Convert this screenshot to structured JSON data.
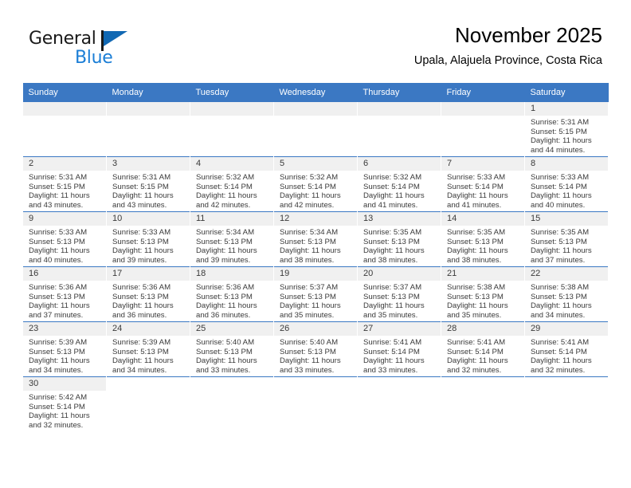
{
  "logo": {
    "word1": "General",
    "word2": "Blue",
    "flag_color": "#1168b3",
    "word2_color": "#1b7ed6"
  },
  "header": {
    "title": "November 2025",
    "subtitle": "Upala, Alajuela Province, Costa Rica"
  },
  "theme": {
    "header_blue": "#3b78c3",
    "daynum_bg": "#f0f0f0",
    "text": "#3a3a3a"
  },
  "weekdays": [
    "Sunday",
    "Monday",
    "Tuesday",
    "Wednesday",
    "Thursday",
    "Friday",
    "Saturday"
  ],
  "labels": {
    "sunrise_prefix": "Sunrise: ",
    "sunset_prefix": "Sunset: ",
    "daylight_prefix": "Daylight: "
  },
  "weeks": [
    [
      {
        "blank": true
      },
      {
        "blank": true
      },
      {
        "blank": true
      },
      {
        "blank": true
      },
      {
        "blank": true
      },
      {
        "blank": true
      },
      {
        "day": "1",
        "line1": "Sunrise: 5:31 AM",
        "line2": "Sunset: 5:15 PM",
        "line3": "Daylight: 11 hours",
        "line4": "and 44 minutes."
      }
    ],
    [
      {
        "day": "2",
        "line1": "Sunrise: 5:31 AM",
        "line2": "Sunset: 5:15 PM",
        "line3": "Daylight: 11 hours",
        "line4": "and 43 minutes."
      },
      {
        "day": "3",
        "line1": "Sunrise: 5:31 AM",
        "line2": "Sunset: 5:15 PM",
        "line3": "Daylight: 11 hours",
        "line4": "and 43 minutes."
      },
      {
        "day": "4",
        "line1": "Sunrise: 5:32 AM",
        "line2": "Sunset: 5:14 PM",
        "line3": "Daylight: 11 hours",
        "line4": "and 42 minutes."
      },
      {
        "day": "5",
        "line1": "Sunrise: 5:32 AM",
        "line2": "Sunset: 5:14 PM",
        "line3": "Daylight: 11 hours",
        "line4": "and 42 minutes."
      },
      {
        "day": "6",
        "line1": "Sunrise: 5:32 AM",
        "line2": "Sunset: 5:14 PM",
        "line3": "Daylight: 11 hours",
        "line4": "and 41 minutes."
      },
      {
        "day": "7",
        "line1": "Sunrise: 5:33 AM",
        "line2": "Sunset: 5:14 PM",
        "line3": "Daylight: 11 hours",
        "line4": "and 41 minutes."
      },
      {
        "day": "8",
        "line1": "Sunrise: 5:33 AM",
        "line2": "Sunset: 5:14 PM",
        "line3": "Daylight: 11 hours",
        "line4": "and 40 minutes."
      }
    ],
    [
      {
        "day": "9",
        "line1": "Sunrise: 5:33 AM",
        "line2": "Sunset: 5:13 PM",
        "line3": "Daylight: 11 hours",
        "line4": "and 40 minutes."
      },
      {
        "day": "10",
        "line1": "Sunrise: 5:33 AM",
        "line2": "Sunset: 5:13 PM",
        "line3": "Daylight: 11 hours",
        "line4": "and 39 minutes."
      },
      {
        "day": "11",
        "line1": "Sunrise: 5:34 AM",
        "line2": "Sunset: 5:13 PM",
        "line3": "Daylight: 11 hours",
        "line4": "and 39 minutes."
      },
      {
        "day": "12",
        "line1": "Sunrise: 5:34 AM",
        "line2": "Sunset: 5:13 PM",
        "line3": "Daylight: 11 hours",
        "line4": "and 38 minutes."
      },
      {
        "day": "13",
        "line1": "Sunrise: 5:35 AM",
        "line2": "Sunset: 5:13 PM",
        "line3": "Daylight: 11 hours",
        "line4": "and 38 minutes."
      },
      {
        "day": "14",
        "line1": "Sunrise: 5:35 AM",
        "line2": "Sunset: 5:13 PM",
        "line3": "Daylight: 11 hours",
        "line4": "and 38 minutes."
      },
      {
        "day": "15",
        "line1": "Sunrise: 5:35 AM",
        "line2": "Sunset: 5:13 PM",
        "line3": "Daylight: 11 hours",
        "line4": "and 37 minutes."
      }
    ],
    [
      {
        "day": "16",
        "line1": "Sunrise: 5:36 AM",
        "line2": "Sunset: 5:13 PM",
        "line3": "Daylight: 11 hours",
        "line4": "and 37 minutes."
      },
      {
        "day": "17",
        "line1": "Sunrise: 5:36 AM",
        "line2": "Sunset: 5:13 PM",
        "line3": "Daylight: 11 hours",
        "line4": "and 36 minutes."
      },
      {
        "day": "18",
        "line1": "Sunrise: 5:36 AM",
        "line2": "Sunset: 5:13 PM",
        "line3": "Daylight: 11 hours",
        "line4": "and 36 minutes."
      },
      {
        "day": "19",
        "line1": "Sunrise: 5:37 AM",
        "line2": "Sunset: 5:13 PM",
        "line3": "Daylight: 11 hours",
        "line4": "and 35 minutes."
      },
      {
        "day": "20",
        "line1": "Sunrise: 5:37 AM",
        "line2": "Sunset: 5:13 PM",
        "line3": "Daylight: 11 hours",
        "line4": "and 35 minutes."
      },
      {
        "day": "21",
        "line1": "Sunrise: 5:38 AM",
        "line2": "Sunset: 5:13 PM",
        "line3": "Daylight: 11 hours",
        "line4": "and 35 minutes."
      },
      {
        "day": "22",
        "line1": "Sunrise: 5:38 AM",
        "line2": "Sunset: 5:13 PM",
        "line3": "Daylight: 11 hours",
        "line4": "and 34 minutes."
      }
    ],
    [
      {
        "day": "23",
        "line1": "Sunrise: 5:39 AM",
        "line2": "Sunset: 5:13 PM",
        "line3": "Daylight: 11 hours",
        "line4": "and 34 minutes."
      },
      {
        "day": "24",
        "line1": "Sunrise: 5:39 AM",
        "line2": "Sunset: 5:13 PM",
        "line3": "Daylight: 11 hours",
        "line4": "and 34 minutes."
      },
      {
        "day": "25",
        "line1": "Sunrise: 5:40 AM",
        "line2": "Sunset: 5:13 PM",
        "line3": "Daylight: 11 hours",
        "line4": "and 33 minutes."
      },
      {
        "day": "26",
        "line1": "Sunrise: 5:40 AM",
        "line2": "Sunset: 5:13 PM",
        "line3": "Daylight: 11 hours",
        "line4": "and 33 minutes."
      },
      {
        "day": "27",
        "line1": "Sunrise: 5:41 AM",
        "line2": "Sunset: 5:14 PM",
        "line3": "Daylight: 11 hours",
        "line4": "and 33 minutes."
      },
      {
        "day": "28",
        "line1": "Sunrise: 5:41 AM",
        "line2": "Sunset: 5:14 PM",
        "line3": "Daylight: 11 hours",
        "line4": "and 32 minutes."
      },
      {
        "day": "29",
        "line1": "Sunrise: 5:41 AM",
        "line2": "Sunset: 5:14 PM",
        "line3": "Daylight: 11 hours",
        "line4": "and 32 minutes."
      }
    ],
    [
      {
        "day": "30",
        "line1": "Sunrise: 5:42 AM",
        "line2": "Sunset: 5:14 PM",
        "line3": "Daylight: 11 hours",
        "line4": "and 32 minutes."
      },
      {
        "outside": true
      },
      {
        "outside": true
      },
      {
        "outside": true
      },
      {
        "outside": true
      },
      {
        "outside": true
      },
      {
        "outside": true
      }
    ]
  ]
}
